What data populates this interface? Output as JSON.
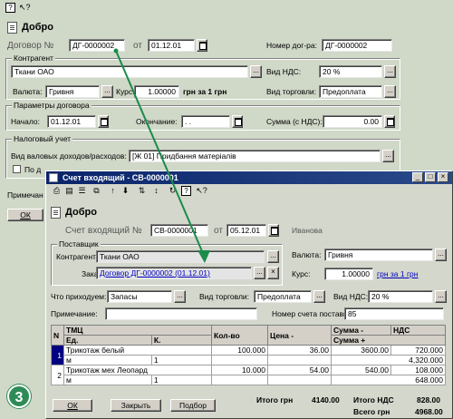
{
  "toolbar_top": {
    "help_icon": "?",
    "whatsthis_icon": "↖?"
  },
  "main": {
    "title": "Добро",
    "contract_label": "Договор №",
    "contract_value": "ДГ-0000002",
    "from_label": "от",
    "contract_date": "01.12.01",
    "contract_num_label": "Номер дог-ра:",
    "contract_num_value": "ДГ-0000002",
    "counterparty_group": "Контрагент",
    "counterparty_value": "Ткани ОАО",
    "vat_type_label": "Вид НДС:",
    "vat_type_value": "20 %",
    "currency_label": "Валюта:",
    "currency_value": "Гривня",
    "rate_label": "Курс:",
    "rate_value": "1.00000",
    "rate_unit": "грн за 1 грн",
    "trade_type_label": "Вид торговли:",
    "trade_type_value": "Предоплата",
    "params_group": "Параметры договора",
    "start_label": "Начало:",
    "start_value": "01.12.01",
    "end_label": "Окончание:",
    "end_value": ". .",
    "sum_label": "Сумма (с НДС):",
    "sum_value": "0.00",
    "tax_group": "Налоговый учет",
    "gross_label": "Вид валовых доходов/расходов:",
    "gross_value": "[Ж 01] Придбання матеріалів",
    "by_label": "По д",
    "note_label": "Примечан",
    "ok_label": "ОК"
  },
  "invoice": {
    "title": "Счет входящий - СВ-0000001",
    "header_title": "Добро",
    "number_label": "Счет входящий №",
    "number_value": "СВ-0000001",
    "from_label": "от",
    "date_value": "05.12.01",
    "user": "Иванова",
    "supplier_group": "Поставщик",
    "counterparty_label": "Контрагент:",
    "counterparty_value": "Ткани ОАО",
    "order_label": "Заказ:",
    "order_value": "Договор ДГ-0000002 (01.12.01)",
    "currency_label": "Валюта:",
    "currency_value": "Гривня",
    "rate_label": "Курс:",
    "rate_value": "1.00000",
    "rate_unit": "грн за 1 грн",
    "incoming_label": "Что приходуем:",
    "incoming_value": "Запасы",
    "trade_label": "Вид торговли:",
    "trade_value": "Предоплата",
    "vat_label": "Вид НДС:",
    "vat_value": "20 %",
    "note_label": "Примечание:",
    "note_value": "",
    "supplier_invoice_label": "Номер счета поставщика:",
    "supplier_invoice_value": "85",
    "table": {
      "headers": [
        "N",
        "ТМЦ",
        "Кол-во",
        "Цена -",
        "Сумма -",
        "НДС"
      ],
      "subheaders": [
        "Ед.",
        "К.",
        "Сумма +"
      ],
      "rows": [
        {
          "n": "1",
          "item": "Трикотаж белый",
          "unit": "м",
          "coef": "1",
          "qty": "100.000",
          "price": "36.00",
          "sum": "3600.00",
          "vat": "720.000",
          "total": "4,320.000"
        },
        {
          "n": "2",
          "item": "Трикотаж мех Леопард",
          "unit": "м",
          "coef": "1",
          "qty": "10.000",
          "price": "54.00",
          "sum": "540.00",
          "vat": "108.000",
          "total": "648.000"
        }
      ]
    },
    "ok_label": "ОК",
    "close_label": "Закрыть",
    "select_label": "Подбор",
    "total_label": "Итого грн",
    "total_value": "4140.00",
    "total_vat_label": "Итого НДС",
    "total_vat_value": "828.00",
    "total_all_label": "Всего грн",
    "total_all_value": "4968.00"
  },
  "badge": "3",
  "colors": {
    "arrow": "#1a8c4a",
    "titlebar": "#0a246a",
    "selected_row": "#000080",
    "link": "#0000c0"
  }
}
